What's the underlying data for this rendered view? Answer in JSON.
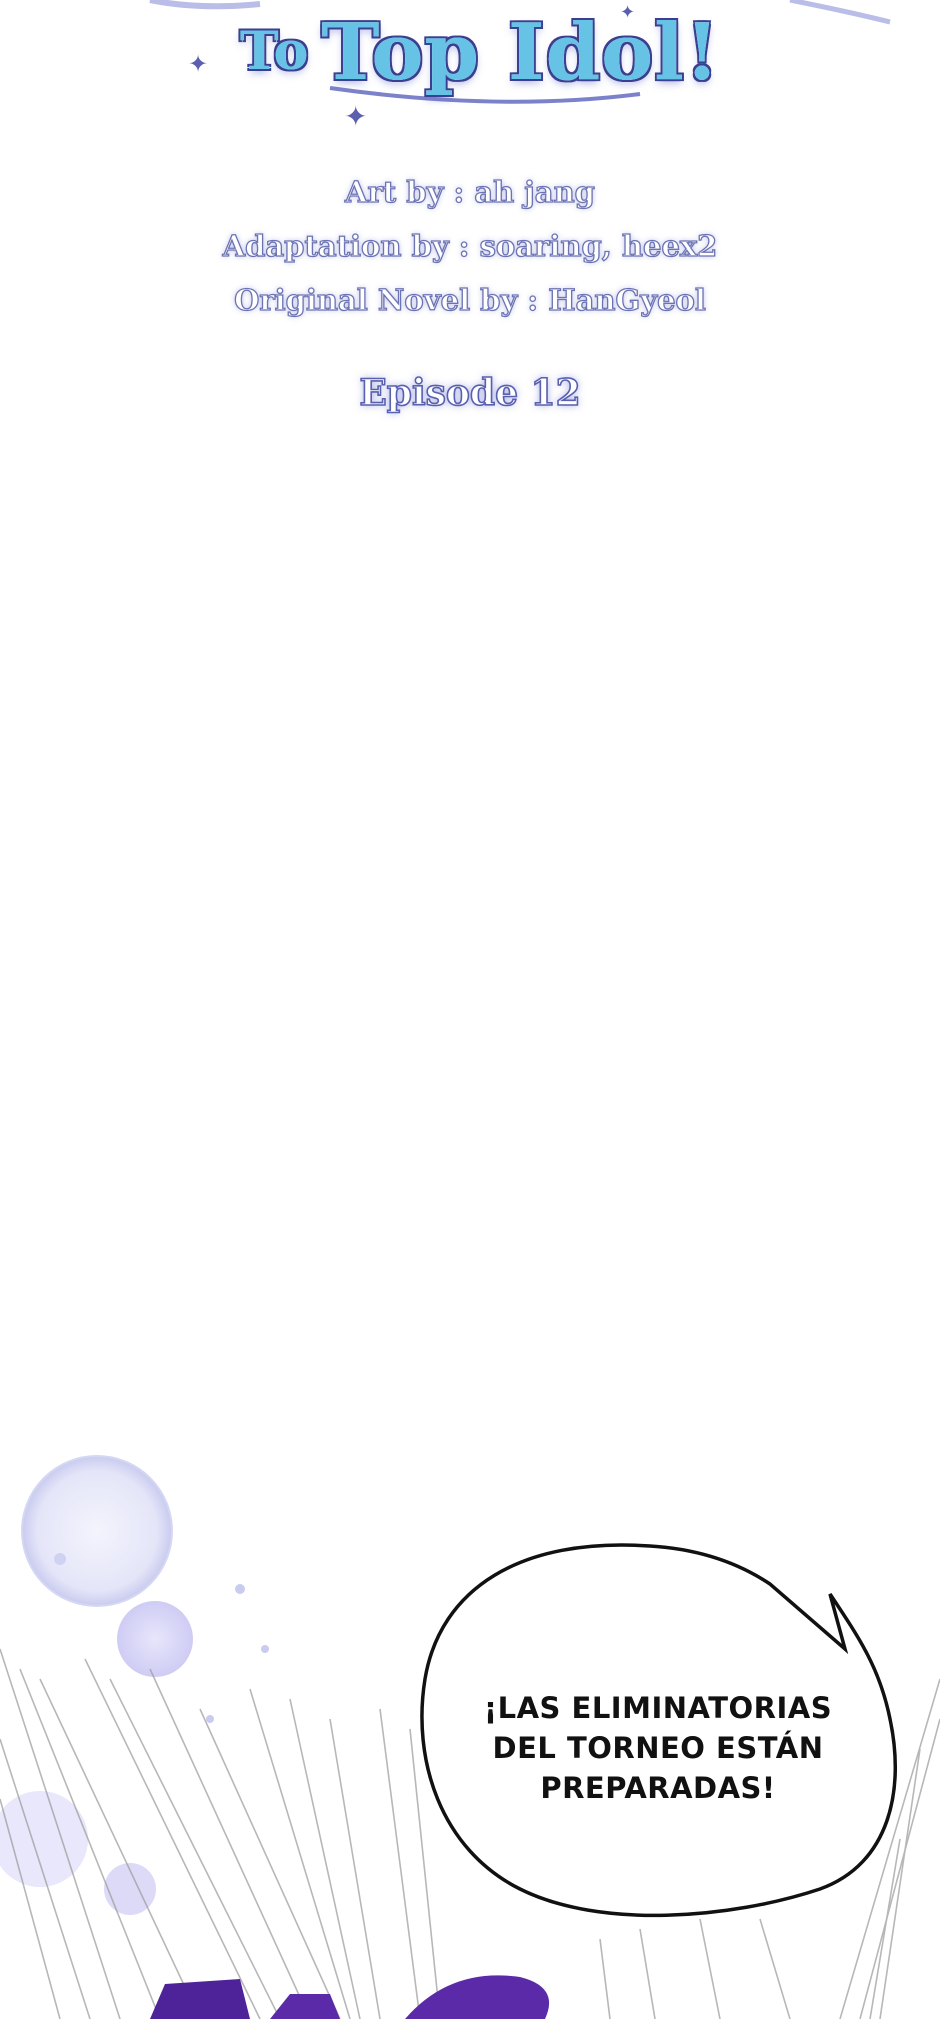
{
  "header": {
    "title_prefix": "To",
    "title_main": "Top Idol!",
    "credits": [
      "Art by : ah jang",
      "Adaptation by : soaring, heex2",
      "Original Novel by : HanGyeol"
    ],
    "episode": "Episode 12"
  },
  "speech_bubble": {
    "lines": [
      "¡LAS ELIMINATORIAS",
      "DEL TORNEO ESTÁN",
      "PREPARADAS!"
    ]
  },
  "colors": {
    "title_fill": "#67c3e6",
    "title_outline": "#3b3f8f",
    "credit_outline": "#6c73b3",
    "bubble_outline": "#111111",
    "bottom_lettering": "#5b2aa8",
    "bubbles": "#d9dbf5"
  }
}
